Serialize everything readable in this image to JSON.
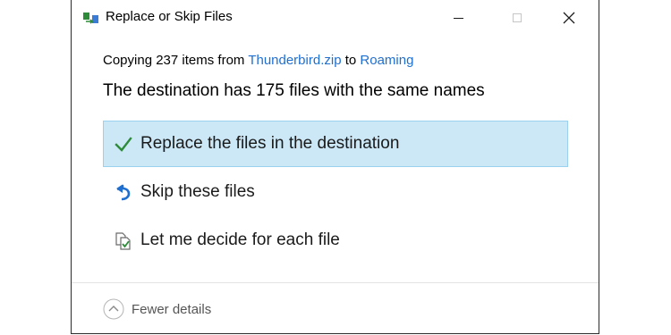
{
  "window": {
    "title": "Replace or Skip Files",
    "title_icon": "copy-files-icon",
    "controls": {
      "minimize": "minimize-icon",
      "maximize": "maximize-icon",
      "close": "close-icon"
    }
  },
  "copy_status": {
    "prefix": "Copying 237 items from",
    "source": "Thunderbird.zip",
    "connector": "to",
    "destination": "Roaming"
  },
  "headline": "The destination has 175 files with the same names",
  "options": [
    {
      "label": "Replace the files in the destination",
      "icon": "checkmark-icon",
      "selected": true
    },
    {
      "label": "Skip these files",
      "icon": "skip-arrow-icon",
      "selected": false
    },
    {
      "label": "Let me decide for each file",
      "icon": "compare-files-icon",
      "selected": false
    }
  ],
  "footer": {
    "label": "Fewer details",
    "icon": "chevron-up-circle-icon"
  },
  "colors": {
    "link": "#1f6fd1",
    "selected_background": "#cce8f7",
    "selected_border": "#99d1ef",
    "checkmark": "#2e8b3a",
    "skip_icon": "#1f6fd1"
  }
}
